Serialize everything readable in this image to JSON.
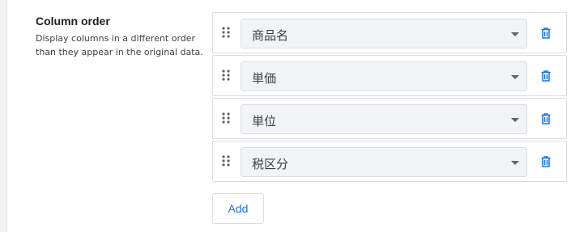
{
  "section": {
    "title": "Column order",
    "description": "Display columns in a different order than they appear in the original data."
  },
  "columns": [
    {
      "value": "商品名"
    },
    {
      "value": "単価"
    },
    {
      "value": "単位"
    },
    {
      "value": "税区分"
    }
  ],
  "add_label": "Add",
  "colors": {
    "accent": "#1a73e8",
    "select_bg": "#f1f3f4",
    "border": "#dadce0"
  },
  "icons": {
    "drag": "drag-handle-icon",
    "delete": "trash-icon",
    "dropdown": "caret-down-icon"
  }
}
